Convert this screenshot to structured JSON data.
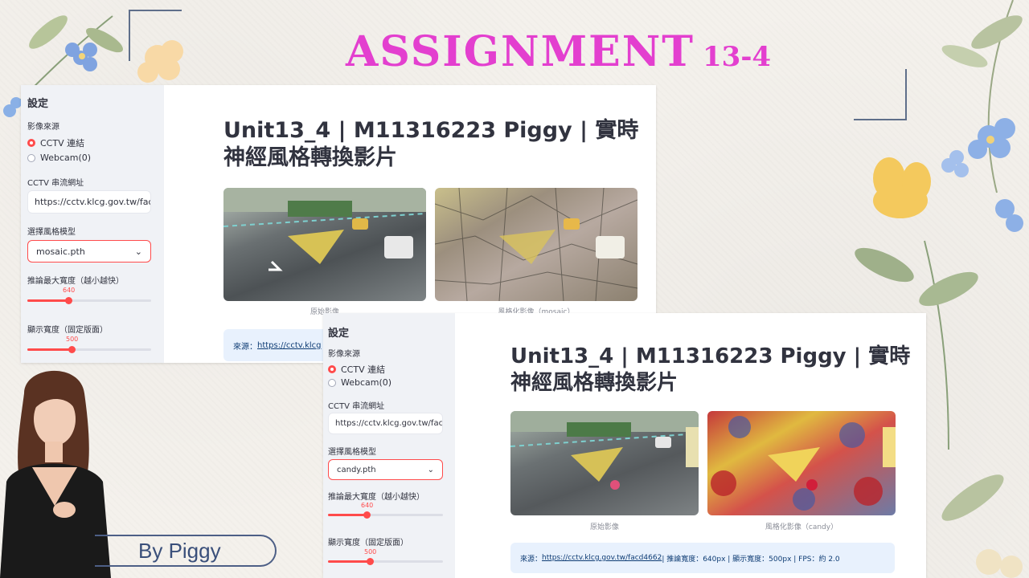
{
  "slide": {
    "title_main": "ASSIGNMENT",
    "title_num": "13-4",
    "by_label": "By Piggy"
  },
  "colors": {
    "accent": "#ff4b4b",
    "title_pink": "#e33fcf",
    "info_bg": "#e8f1fd"
  },
  "window1": {
    "sidebar": {
      "header": "設定",
      "source_label": "影像來源",
      "source_options": [
        "CCTV 連結",
        "Webcam(0)"
      ],
      "source_selected": "CCTV 連結",
      "url_label": "CCTV 串流網址",
      "url_value": "https://cctv.klcg.gov.tw/facd",
      "model_label": "選擇風格模型",
      "model_value": "mosaic.pth",
      "max_width_label": "推論最大寬度（越小越快）",
      "max_width_value": 640,
      "display_width_label": "顯示寬度（固定版面）",
      "display_width_value": 500
    },
    "main": {
      "title": "Unit13_4 | M11316223 Piggy | 實時神經風格轉換影片",
      "caption_original": "原始影像",
      "caption_styled": "風格化影像（mosaic）",
      "info_prefix": "來源：",
      "info_link": "https://cctv.klcg"
    }
  },
  "window2": {
    "sidebar": {
      "header": "設定",
      "source_label": "影像來源",
      "source_options": [
        "CCTV 連結",
        "Webcam(0)"
      ],
      "source_selected": "CCTV 連結",
      "url_label": "CCTV 串流網址",
      "url_value": "https://cctv.klcg.gov.tw/facd",
      "model_label": "選擇風格模型",
      "model_value": "candy.pth",
      "max_width_label": "推論最大寬度（越小越快）",
      "max_width_value": 640,
      "display_width_label": "顯示寬度（固定版面）",
      "display_width_value": 500
    },
    "main": {
      "title": "Unit13_4 | M11316223 Piggy | 實時神經風格轉換影片",
      "caption_original": "原始影像",
      "caption_styled": "風格化影像（candy）",
      "info_prefix": "來源：",
      "info_link": "https://cctv.klcg.gov.tw/facd4662",
      "info_suffix": " | 推論寬度：640px | 顯示寬度：500px | FPS：約 2.0"
    }
  }
}
